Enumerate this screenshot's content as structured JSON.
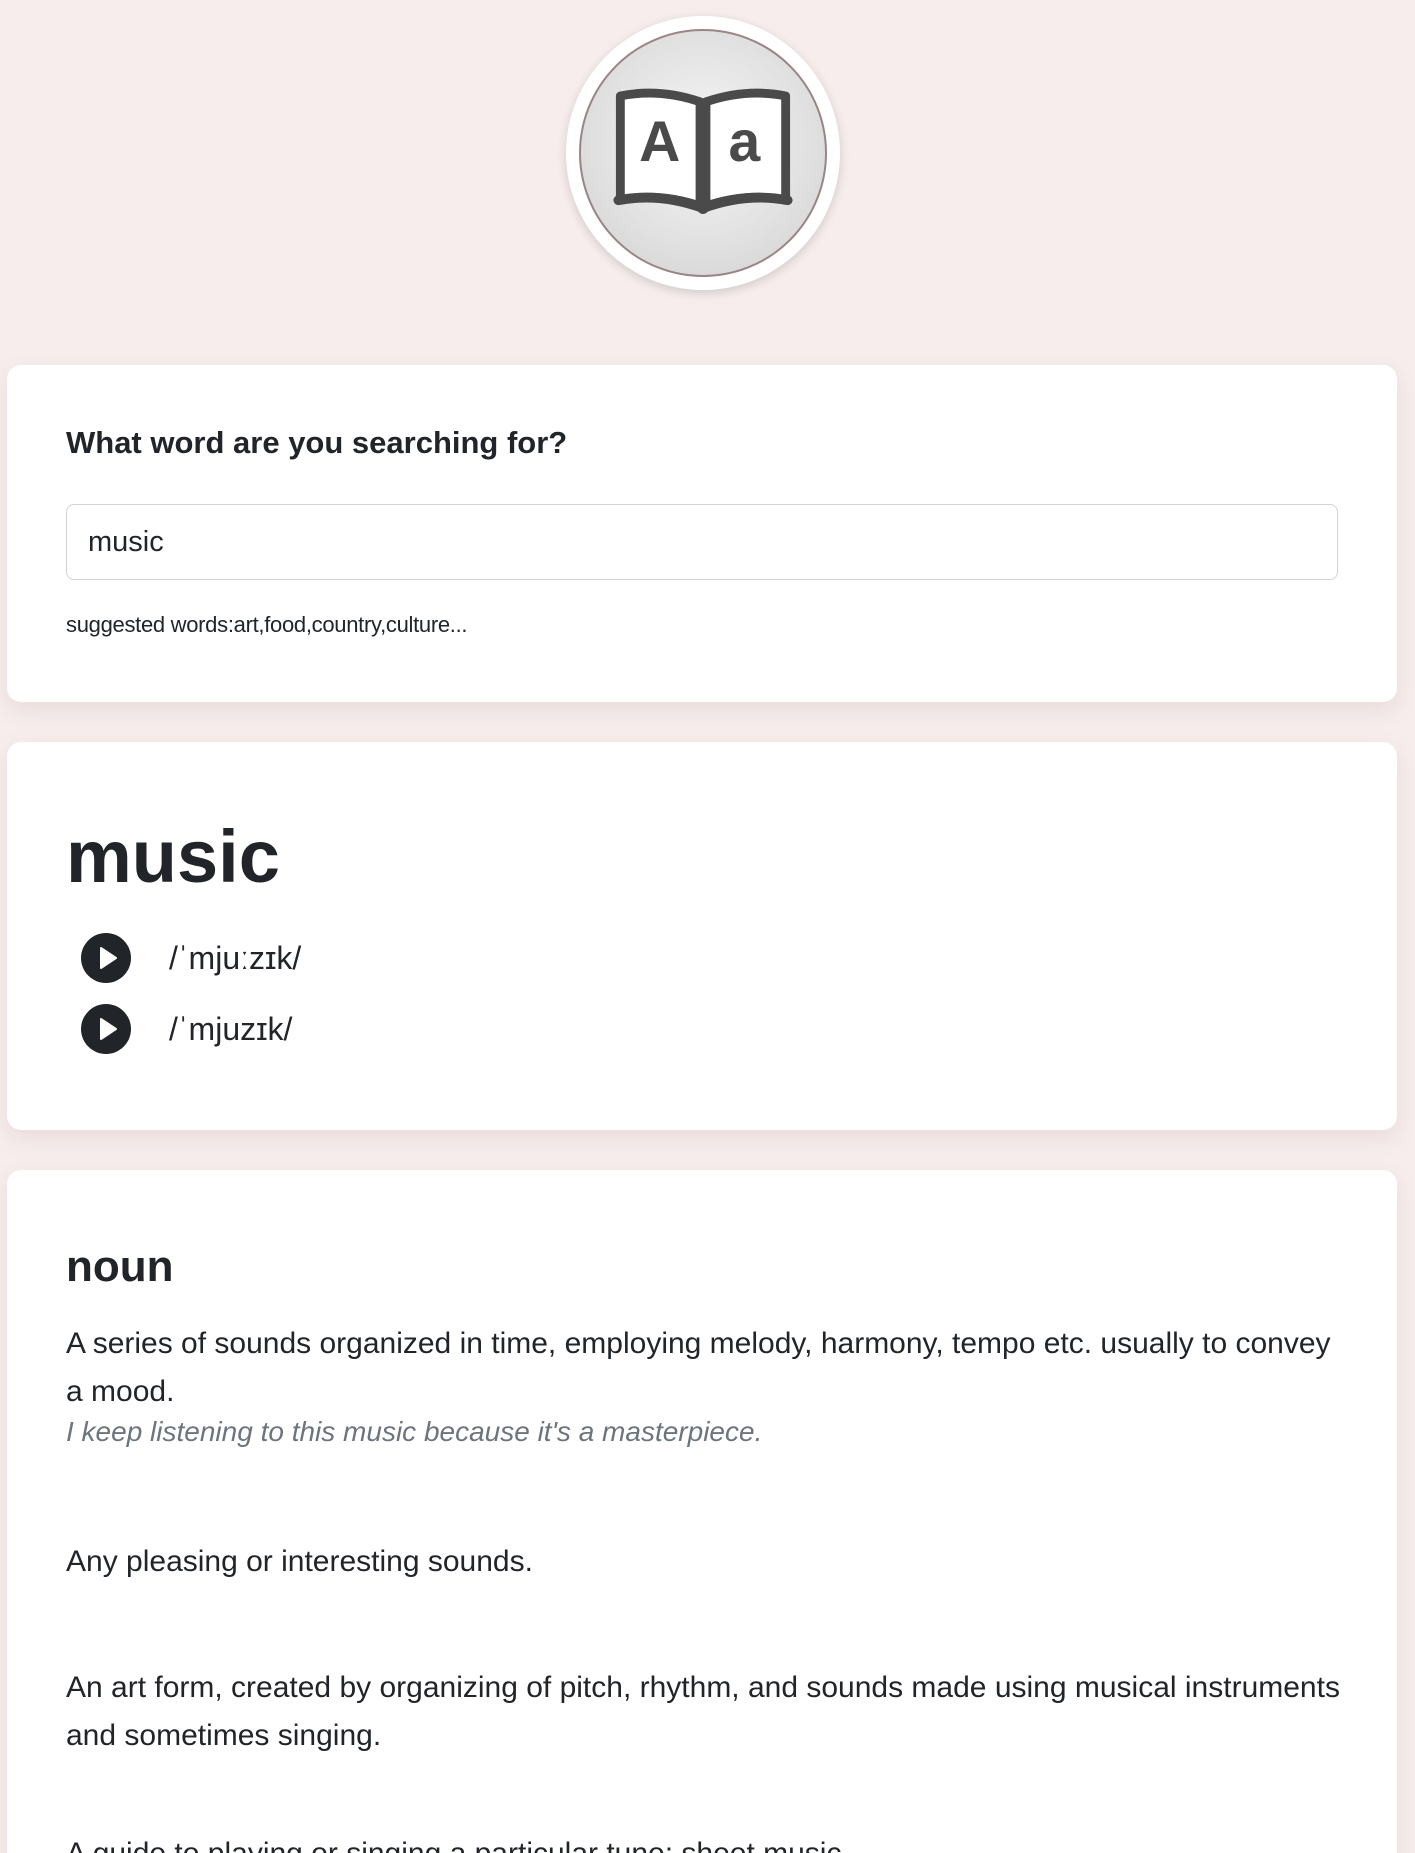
{
  "logo": {
    "letter_upper": "A",
    "letter_lower": "a"
  },
  "search": {
    "label": "What word are you searching for?",
    "value": "music",
    "suggested": "suggested words:art,food,country,culture..."
  },
  "word": {
    "title": "music",
    "phonetics": [
      {
        "text": "/ˈmjuːzɪk/"
      },
      {
        "text": "/ˈmjuzɪk/"
      }
    ]
  },
  "meaning": {
    "part_of_speech": "noun",
    "definitions": [
      {
        "text": "A series of sounds organized in time, employing melody, harmony, tempo etc. usually to convey a mood.",
        "example": "I keep listening to this music because it's a masterpiece."
      },
      {
        "text": "Any pleasing or interesting sounds."
      },
      {
        "text": "An art form, created by organizing of pitch, rhythm, and sounds made using musical instruments and sometimes singing."
      },
      {
        "text": "A guide to playing or singing a particular tune; sheet music."
      }
    ]
  },
  "colors": {
    "background": "#f6edec",
    "card": "#ffffff",
    "text": "#212529",
    "muted": "#6c757d",
    "icon_dark": "#4a4a4a"
  }
}
